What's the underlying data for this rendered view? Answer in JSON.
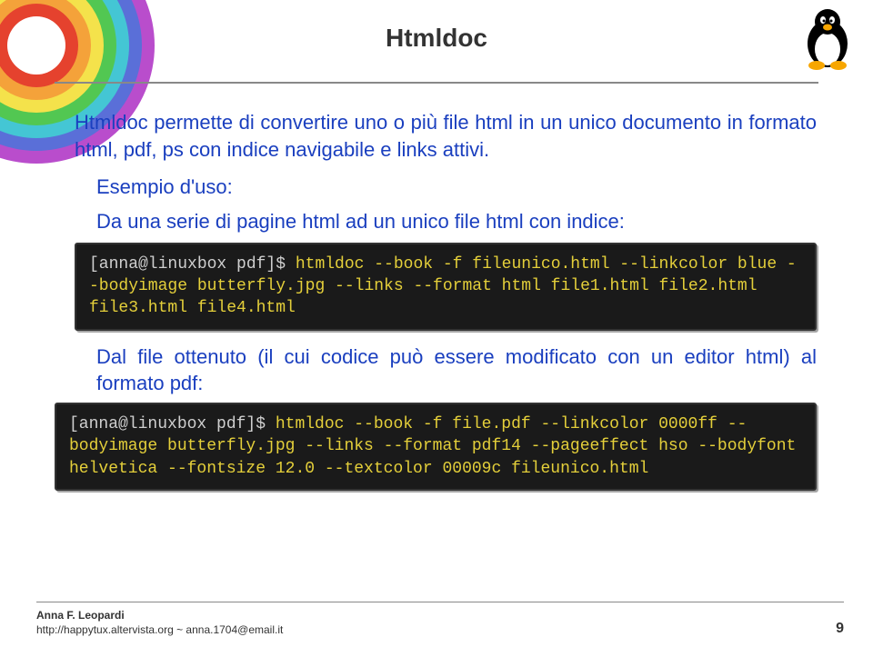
{
  "title": "Htmldoc",
  "paragraph1": "Htmldoc permette di convertire uno o più file html in un unico documento in formato html, pdf, ps con indice navigabile e links attivi.",
  "sub1": "Esempio d'uso:",
  "sub2": "Da una serie di pagine html ad un unico file html con indice:",
  "term1": {
    "prompt": "[anna@linuxbox pdf]$ ",
    "cmd": "htmldoc --book -f fileunico.html --linkcolor blue --bodyimage butterfly.jpg --links  --format html file1.html file2.html file3.html file4.html"
  },
  "paragraph2": "Dal file ottenuto (il cui codice può essere modificato con un editor html) al formato pdf:",
  "term2": {
    "prompt": "[anna@linuxbox pdf]$ ",
    "cmd": "htmldoc --book -f file.pdf --linkcolor 0000ff --bodyimage butterfly.jpg --links  --format pdf14   --pageeffect hso --bodyfont helvetica  --fontsize 12.0 --textcolor 00009c  fileunico.html"
  },
  "footer": {
    "author": "Anna F. Leopardi",
    "link": "http://happytux.altervista.org ~ anna.1704@email.it"
  },
  "page_number": "9"
}
